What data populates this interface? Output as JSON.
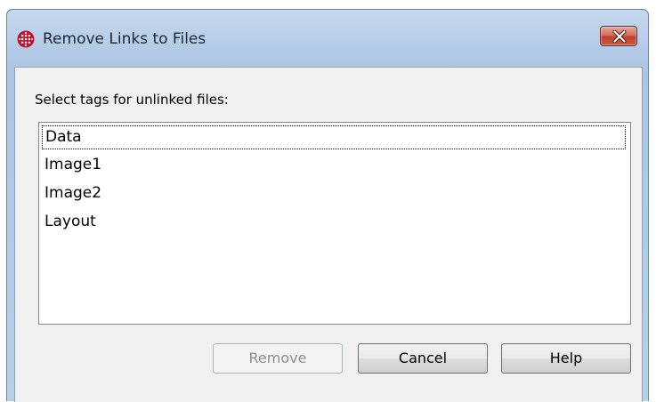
{
  "window": {
    "title": "Remove Links to Files",
    "app_icon": "grid-circle-icon",
    "close_icon": "close-icon",
    "accent_color": "#c2412b"
  },
  "dialog": {
    "prompt": "Select tags for unlinked files:",
    "tags": [
      "Data",
      "Image1",
      "Image2",
      "Layout"
    ],
    "focused_tag": "Data"
  },
  "buttons": {
    "remove": "Remove",
    "cancel": "Cancel",
    "help": "Help"
  }
}
